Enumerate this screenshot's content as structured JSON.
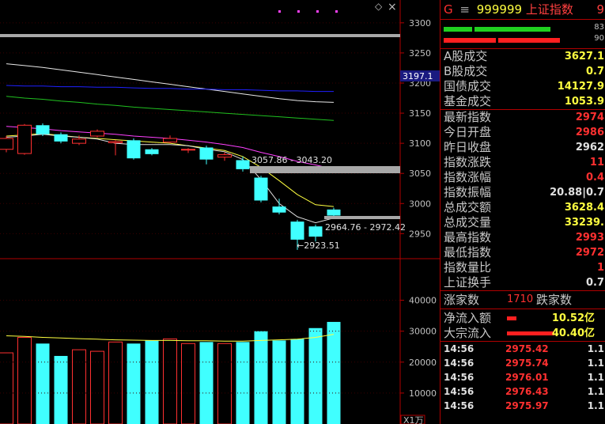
{
  "header": {
    "g_label": "G",
    "menu_glyph": "≡",
    "code": "999999",
    "name": "上证指数",
    "cut": "9"
  },
  "chart": {
    "top_icons": {
      "diamond": "◇",
      "close": "×"
    },
    "price_ticks": [
      "3300",
      "3250",
      "3200",
      "3150",
      "3100",
      "3050",
      "3000",
      "2950"
    ],
    "current_price_tag": "3197.1",
    "annotation_upper": "3057.86 - 3043.20",
    "annotation_lower": "2964.76 - 2972.42",
    "annotation_low": "←2923.51",
    "volume_ticks": [
      "40000",
      "30000",
      "20000",
      "10000"
    ],
    "volume_unit": "X1万"
  },
  "panel": {
    "top_bar_numbers": [
      "83",
      "90"
    ],
    "stats_a": [
      {
        "label": "A股成交",
        "value": "3627.1",
        "color": "y"
      },
      {
        "label": "B股成交",
        "value": "0.7",
        "color": "y"
      },
      {
        "label": "国债成交",
        "value": "14127.9",
        "color": "y"
      },
      {
        "label": "基金成交",
        "value": "1053.9",
        "color": "y"
      }
    ],
    "stats_b": [
      {
        "label": "最新指数",
        "value": "2974",
        "color": "r"
      },
      {
        "label": "今日开盘",
        "value": "2986",
        "color": "r"
      },
      {
        "label": "昨日收盘",
        "value": "2962",
        "color": "w"
      },
      {
        "label": "指数涨跌",
        "value": "11",
        "color": "r"
      },
      {
        "label": "指数涨幅",
        "value": "0.4",
        "color": "r"
      },
      {
        "label": "指数振幅",
        "value": "20.88|0.7",
        "color": "w"
      },
      {
        "label": "总成交额",
        "value": "3628.4",
        "color": "y"
      },
      {
        "label": "总成交量",
        "value": "33239.",
        "color": "y"
      },
      {
        "label": "最高指数",
        "value": "2993",
        "color": "r"
      },
      {
        "label": "最低指数",
        "value": "2972",
        "color": "r"
      },
      {
        "label": "指数量比",
        "value": "1",
        "color": "r"
      },
      {
        "label": "上证换手",
        "value": "0.7",
        "color": "w"
      }
    ],
    "breadth": {
      "up_label": "涨家数",
      "up_value": "1710",
      "down_label": "跌家数"
    },
    "flows": [
      {
        "label": "净流入额",
        "value": "10.52亿",
        "bar": 0.12
      },
      {
        "label": "大宗流入",
        "value": "40.40亿",
        "bar": 0.6
      }
    ],
    "ticks": [
      {
        "time": "14:56",
        "price": "2975.42",
        "vol": "1.1"
      },
      {
        "time": "14:56",
        "price": "2975.74",
        "vol": "1.1"
      },
      {
        "time": "14:56",
        "price": "2976.01",
        "vol": "1.1"
      },
      {
        "time": "14:56",
        "price": "2976.43",
        "vol": "1.1"
      },
      {
        "time": "14:56",
        "price": "2975.97",
        "vol": "1.1"
      }
    ]
  },
  "chart_data": {
    "type": "candlestick",
    "y_range": [
      2915,
      3330
    ],
    "candles": [
      {
        "o": 3090,
        "c": 3108,
        "h": 3112,
        "l": 3085
      },
      {
        "o": 3083,
        "c": 3130,
        "h": 3132,
        "l": 3081
      },
      {
        "o": 3130,
        "c": 3115,
        "h": 3133,
        "l": 3112
      },
      {
        "o": 3115,
        "c": 3103,
        "h": 3118,
        "l": 3100
      },
      {
        "o": 3100,
        "c": 3107,
        "h": 3113,
        "l": 3097
      },
      {
        "o": 3112,
        "c": 3120,
        "h": 3123,
        "l": 3110
      },
      {
        "o": 3101,
        "c": 3103,
        "h": 3105,
        "l": 3080
      },
      {
        "o": 3105,
        "c": 3075,
        "h": 3108,
        "l": 3073
      },
      {
        "o": 3090,
        "c": 3082,
        "h": 3092,
        "l": 3080
      },
      {
        "o": 3102,
        "c": 3108,
        "h": 3113,
        "l": 3100
      },
      {
        "o": 3090,
        "c": 3090,
        "h": 3092,
        "l": 3084
      },
      {
        "o": 3093,
        "c": 3073,
        "h": 3096,
        "l": 3065
      },
      {
        "o": 3077,
        "c": 3081,
        "h": 3085,
        "l": 3071
      },
      {
        "o": 3072,
        "c": 3057,
        "h": 3078,
        "l": 3053
      },
      {
        "o": 3043,
        "c": 3005,
        "h": 3046,
        "l": 3002
      },
      {
        "o": 2995,
        "c": 2985,
        "h": 3008,
        "l": 2982
      },
      {
        "o": 2970,
        "c": 2940,
        "h": 2973,
        "l": 2923
      },
      {
        "o": 2962,
        "c": 2945,
        "h": 2965,
        "l": 2937
      },
      {
        "o": 2990,
        "c": 2980,
        "h": 2993,
        "l": 2978
      }
    ],
    "volumes": [
      23000,
      28000,
      26000,
      22000,
      24000,
      23500,
      26500,
      26000,
      27000,
      27500,
      26000,
      26500,
      26000,
      26500,
      30000,
      27000,
      27500,
      31000,
      33000
    ],
    "ma_lines": [
      {
        "color": "#e8e8e8",
        "values": [
          3232,
          3229,
          3226,
          3222,
          3218,
          3214,
          3210,
          3206,
          3202,
          3198,
          3194,
          3190,
          3186,
          3182,
          3178,
          3174,
          3171,
          3169,
          3168
        ]
      },
      {
        "color": "#2020ff",
        "values": [
          3196,
          3195,
          3195,
          3194,
          3194,
          3193,
          3193,
          3192,
          3191,
          3191,
          3190,
          3190,
          3189,
          3189,
          3188,
          3187,
          3187,
          3186,
          3186
        ]
      },
      {
        "color": "#20c020",
        "values": [
          3178,
          3175,
          3173,
          3170,
          3168,
          3165,
          3163,
          3160,
          3158,
          3156,
          3154,
          3152,
          3150,
          3148,
          3146,
          3144,
          3142,
          3140,
          3138
        ]
      },
      {
        "color": "#ff40ff",
        "values": [
          3128,
          3126,
          3124,
          3121,
          3119,
          3117,
          3115,
          3112,
          3110,
          3108,
          3105,
          3102,
          3098,
          3093,
          3085,
          3078,
          3070,
          3064,
          3057
        ]
      },
      {
        "color": "#ffff40",
        "values": [
          3112,
          3114,
          3116,
          3113,
          3110,
          3108,
          3106,
          3104,
          3102,
          3100,
          3096,
          3092,
          3088,
          3078,
          3060,
          3038,
          3015,
          2998,
          2995
        ]
      },
      {
        "color": "#e0e0e0",
        "values": [
          3110,
          3112,
          3115,
          3112,
          3110,
          3107,
          3100,
          3098,
          3098,
          3098,
          3096,
          3090,
          3086,
          3073,
          3040,
          3000,
          2978,
          2968,
          2976
        ]
      }
    ],
    "volume_ma": [
      28500,
      28300,
      28000,
      27800,
      27600,
      27400,
      27200,
      27100,
      27000,
      27000,
      26900,
      26900,
      26800,
      26800,
      27000,
      27200,
      27400,
      28000,
      29000
    ],
    "volume_range": [
      0,
      45000
    ]
  }
}
